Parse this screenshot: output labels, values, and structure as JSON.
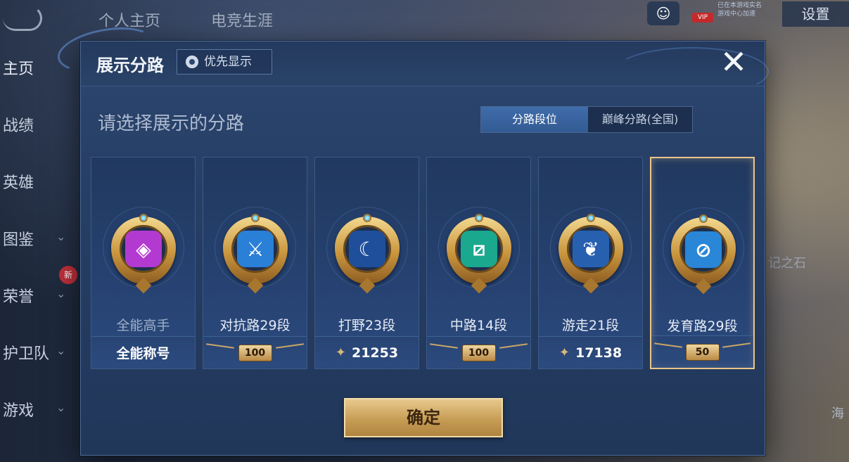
{
  "background": {
    "top_tabs": [
      "个人主页",
      "电竞生涯"
    ],
    "settings_label": "设置",
    "vip_label": "VIP",
    "vip_text_1": "已在本游戏实名",
    "vip_text_2": "游戏中心加速",
    "sidebar": [
      {
        "label": "主页",
        "chevron": false,
        "new": false
      },
      {
        "label": "战绩",
        "chevron": false,
        "new": false
      },
      {
        "label": "英雄",
        "chevron": false,
        "new": false
      },
      {
        "label": "图鉴",
        "chevron": true,
        "new": false
      },
      {
        "label": "荣誉",
        "chevron": true,
        "new": true
      },
      {
        "label": "护卫队",
        "chevron": true,
        "new": false
      },
      {
        "label": "游戏",
        "chevron": true,
        "new": false
      }
    ],
    "new_badge": "新",
    "stone_label": "记之石",
    "hai_label": "海"
  },
  "modal": {
    "title": "展示分路",
    "priority_label": "优先显示",
    "close_icon": "close-icon",
    "prompt": "请选择展示的分路",
    "tabs": [
      {
        "label": "分路段位",
        "active": true
      },
      {
        "label": "巅峰分路(全国)",
        "active": false
      }
    ],
    "cards": [
      {
        "label": "全能高手",
        "footer_type": "text",
        "footer": "全能称号",
        "core_glyph": "◈",
        "core_color": "#b33ad0",
        "selected": false,
        "dim": true
      },
      {
        "label": "对抗路29段",
        "footer_type": "plaque",
        "footer": "100",
        "core_glyph": "⚔",
        "core_color": "#2a7fd6",
        "selected": false,
        "dim": false
      },
      {
        "label": "打野23段",
        "footer_type": "points",
        "footer": "21253",
        "core_glyph": "☾",
        "core_color": "#1f4f9a",
        "selected": false,
        "dim": false
      },
      {
        "label": "中路14段",
        "footer_type": "plaque",
        "footer": "100",
        "core_glyph": "⧄",
        "core_color": "#1aa88e",
        "selected": false,
        "dim": false
      },
      {
        "label": "游走21段",
        "footer_type": "points",
        "footer": "17138",
        "core_glyph": "❦",
        "core_color": "#2860b0",
        "selected": false,
        "dim": false
      },
      {
        "label": "发育路29段",
        "footer_type": "plaque",
        "footer": "50",
        "core_glyph": "⊘",
        "core_color": "#2a86d6",
        "selected": true,
        "dim": false
      }
    ],
    "points_icon": "star-icon",
    "confirm_label": "确定"
  }
}
